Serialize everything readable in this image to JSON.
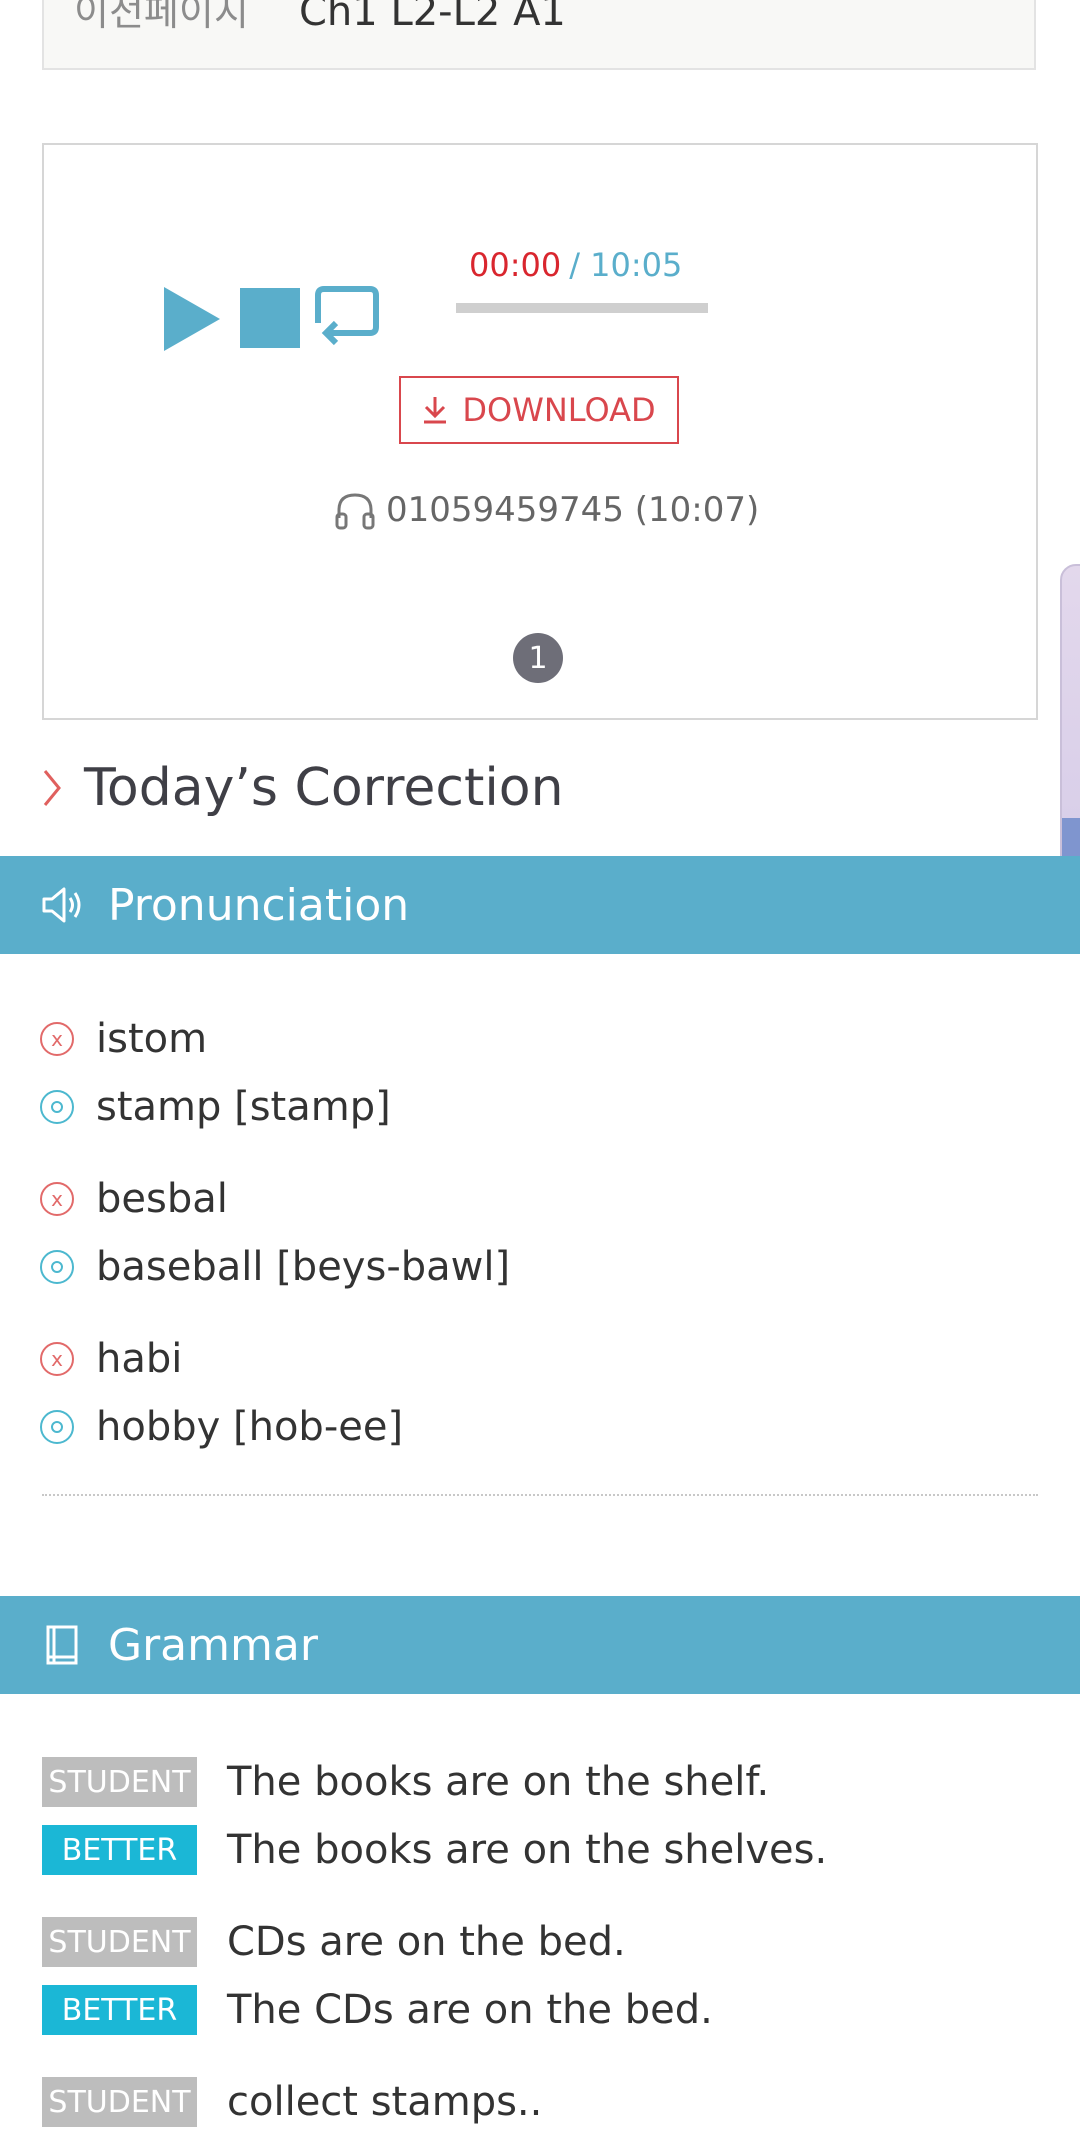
{
  "previous_page": {
    "label": "이전페이지",
    "value": "Ch1 L2-L2 A1"
  },
  "player": {
    "current_time": "00:00",
    "separator": "/",
    "total_time": "10:05",
    "progress_fraction": 0,
    "download_label": "DOWNLOAD",
    "phone_info": "01059459745 (10:07)",
    "page_number": "1",
    "icons": [
      "play-icon",
      "stop-icon",
      "repeat-icon",
      "download-icon",
      "headphones-icon"
    ]
  },
  "correction": {
    "title": "Today’s Correction"
  },
  "pronunciation": {
    "title": "Pronunciation",
    "groups": [
      {
        "wrong": "istom",
        "right": "stamp [stamp]"
      },
      {
        "wrong": "besbal",
        "right": "baseball [beys-bawl]"
      },
      {
        "wrong": "habi",
        "right": "hobby [hob-ee]"
      }
    ]
  },
  "grammar": {
    "title": "Grammar",
    "student_tag": "STUDENT",
    "better_tag": "BETTER",
    "groups": [
      {
        "student": "The books are on the shelf.",
        "better": "The books are on the shelves."
      },
      {
        "student": "CDs are on the bed.",
        "better": "The CDs are on the bed."
      },
      {
        "student": "collect stamps..",
        "better": ""
      }
    ]
  },
  "colors": {
    "accent_blue": "#5aaecb",
    "time_red": "#d9262e",
    "better_cyan": "#1bb7d6",
    "student_gray": "#bdbdbd"
  }
}
